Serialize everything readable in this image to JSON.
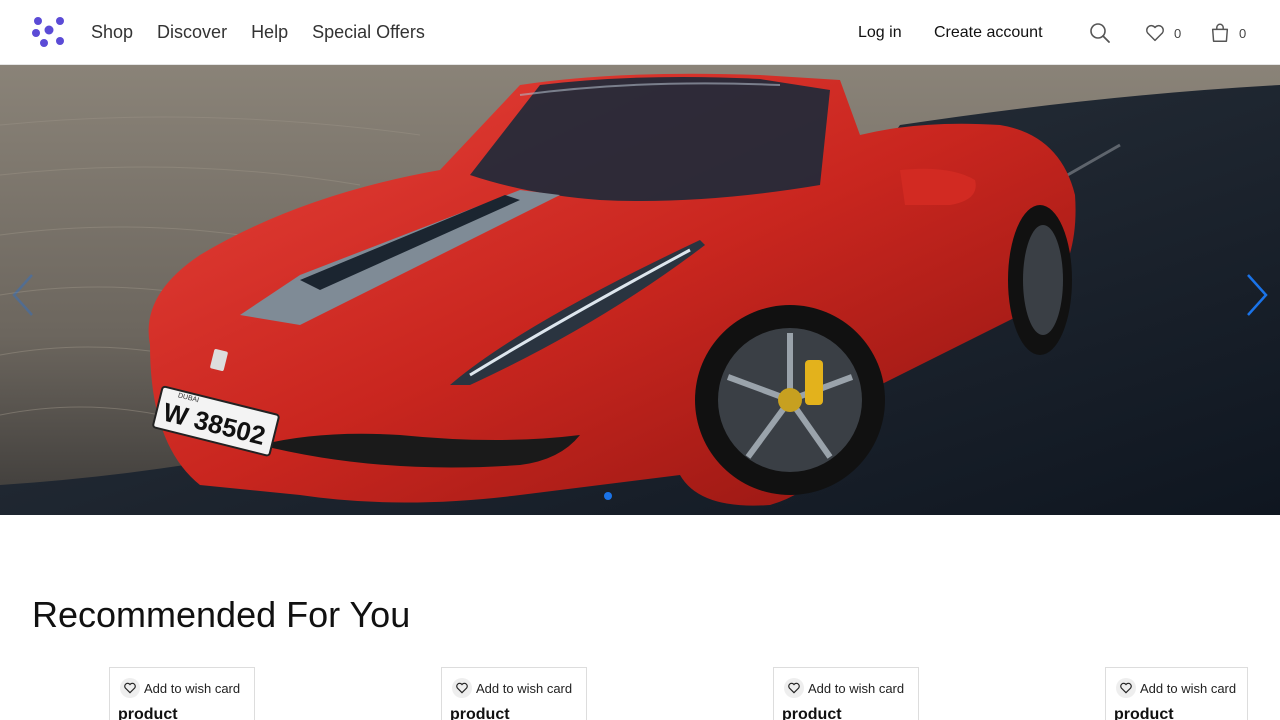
{
  "header": {
    "nav": [
      "Shop",
      "Discover",
      "Help",
      "Special Offers"
    ],
    "login_label": "Log in",
    "create_label": "Create account",
    "wishlist_count": "0",
    "cart_count": "0",
    "icons": {
      "logo": "brand-logo",
      "search": "search-icon",
      "wishlist": "heart-icon",
      "cart": "shopping-bag-icon"
    },
    "logo_color": "#5b4bd6"
  },
  "hero": {
    "plate_text": "W 38502",
    "plate_region": "DUBAI",
    "active_slide": 1,
    "accent_color": "#1a73e8"
  },
  "recommended": {
    "title": "Recommended For You",
    "products": [
      {
        "wish_label": "Add to wish card",
        "name": "product"
      },
      {
        "wish_label": "Add to wish card",
        "name": "product"
      },
      {
        "wish_label": "Add to wish card",
        "name": "product"
      },
      {
        "wish_label": "Add to wish card",
        "name": "product"
      }
    ]
  }
}
